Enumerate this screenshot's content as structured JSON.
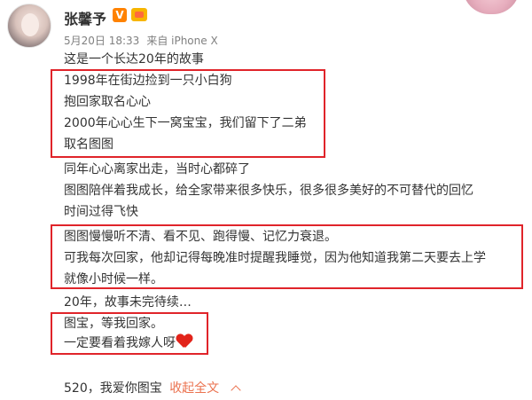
{
  "post": {
    "author": "张馨予",
    "verified_badge": "V",
    "timestamp": "5月20日 18:33",
    "source": "来自 iPhone X",
    "lines": [
      "这是一个长达20年的故事",
      "1998年在街边捡到一只小白狗",
      "抱回家取名心心",
      "2000年心心生下一窝宝宝，我们留下了二弟",
      "取名图图",
      "同年心心离家出走，当时心都碎了",
      "图图陪伴着我成长，给全家带来很多快乐，很多很多美好的不可替代的回忆",
      "时间过得飞快",
      "图图慢慢听不清、看不见、跑得慢、记忆力衰退。",
      "可我每次回家，他却记得每晚准时提醒我睡觉，因为他知道我第二天要去上学",
      "就像小时候一样。",
      "20年，故事未完待续…",
      "图宝，等我回家。",
      "一定要看着我嫁人呀"
    ],
    "footer_text": "520，我爱你图宝",
    "collapse_label": "收起全文"
  },
  "colors": {
    "highlight_box": "#e0242a",
    "link": "#eb7350",
    "heart": "#e2231a"
  },
  "icons": [
    "avatar",
    "verified-badge-icon",
    "member-icon",
    "heart-icon",
    "chevron-up-icon"
  ]
}
